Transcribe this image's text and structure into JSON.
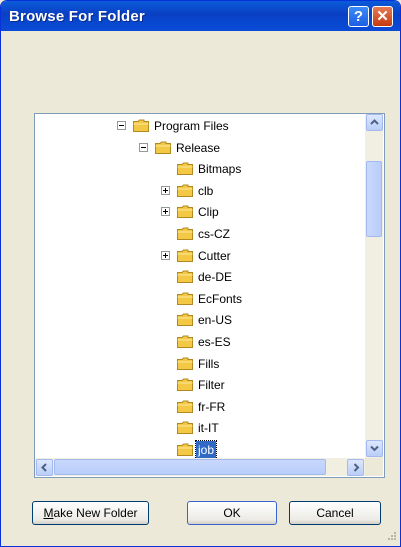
{
  "window": {
    "title": "Browse For Folder"
  },
  "titlebar": {
    "help_glyph": "?",
    "close_glyph": "✕"
  },
  "tree": {
    "items": [
      {
        "label": "Program Files",
        "expander": "minus"
      },
      {
        "label": "Release",
        "expander": "minus"
      },
      {
        "label": "Bitmaps",
        "expander": "none"
      },
      {
        "label": "clb",
        "expander": "plus"
      },
      {
        "label": "Clip",
        "expander": "plus"
      },
      {
        "label": "cs-CZ",
        "expander": "none"
      },
      {
        "label": "Cutter",
        "expander": "plus"
      },
      {
        "label": "de-DE",
        "expander": "none"
      },
      {
        "label": "EcFonts",
        "expander": "none"
      },
      {
        "label": "en-US",
        "expander": "none"
      },
      {
        "label": "es-ES",
        "expander": "none"
      },
      {
        "label": "Fills",
        "expander": "none"
      },
      {
        "label": "Filter",
        "expander": "none"
      },
      {
        "label": "fr-FR",
        "expander": "none"
      },
      {
        "label": "it-IT",
        "expander": "none"
      },
      {
        "label": "job",
        "expander": "none",
        "selected": true
      }
    ]
  },
  "buttons": {
    "make_new_folder_mnemonic": "M",
    "make_new_folder_rest": "ake New Folder",
    "ok": "OK",
    "cancel": "Cancel"
  },
  "colors": {
    "titlebar": "#0A3FC4",
    "selection": "#316AC5",
    "folder": "#F3C845"
  }
}
